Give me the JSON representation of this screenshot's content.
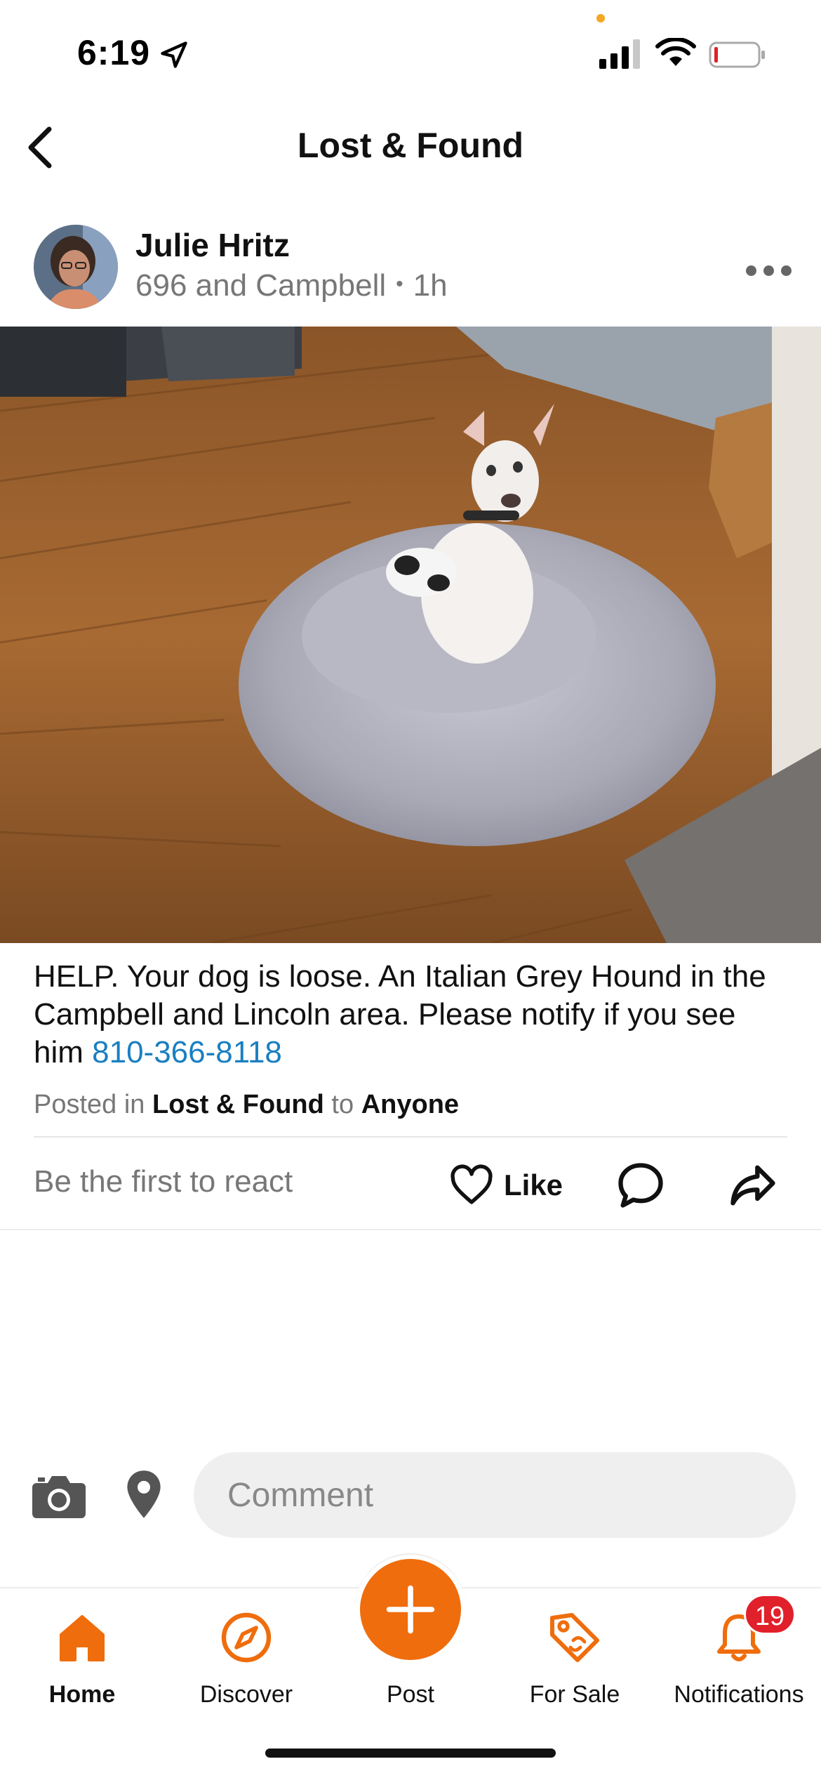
{
  "status_bar": {
    "time": "6:19",
    "icons": [
      "location-arrow-icon",
      "signal-icon",
      "wifi-icon",
      "battery-low-icon"
    ]
  },
  "header": {
    "title": "Lost & Found",
    "back_icon": "chevron-left-icon"
  },
  "post": {
    "author_name": "Julie Hritz",
    "location": "696 and Campbell",
    "time_ago": "1h",
    "more_icon": "ellipsis-icon",
    "image_alt": "White dog sitting in a grey fluffy round bed on a wooden floor",
    "text": "HELP. Your dog is loose. An Italian Grey Hound in the Campbell and Lincoln area.   Please notify if you see him",
    "phone": "810-366-8118",
    "posted_in_prefix": "Posted in",
    "category": "Lost & Found",
    "posted_to": "to",
    "audience": "Anyone"
  },
  "reactions": {
    "prompt": "Be the first to react",
    "like_label": "Like",
    "icons": [
      "heart-icon",
      "comment-bubble-icon",
      "share-arrow-icon"
    ]
  },
  "comment_bar": {
    "placeholder": "Comment",
    "icons": [
      "camera-icon",
      "location-pin-icon"
    ]
  },
  "tabs": [
    {
      "label": "Home",
      "icon": "home-icon",
      "active": true
    },
    {
      "label": "Discover",
      "icon": "compass-icon",
      "active": false
    },
    {
      "label": "Post",
      "icon": "plus-icon",
      "active": false
    },
    {
      "label": "For Sale",
      "icon": "tag-icon",
      "active": false
    },
    {
      "label": "Notifications",
      "icon": "bell-icon",
      "active": false,
      "badge": "19"
    }
  ],
  "colors": {
    "accent": "#ef6d0c",
    "link": "#1a7fc1",
    "badge": "#e0202a"
  }
}
